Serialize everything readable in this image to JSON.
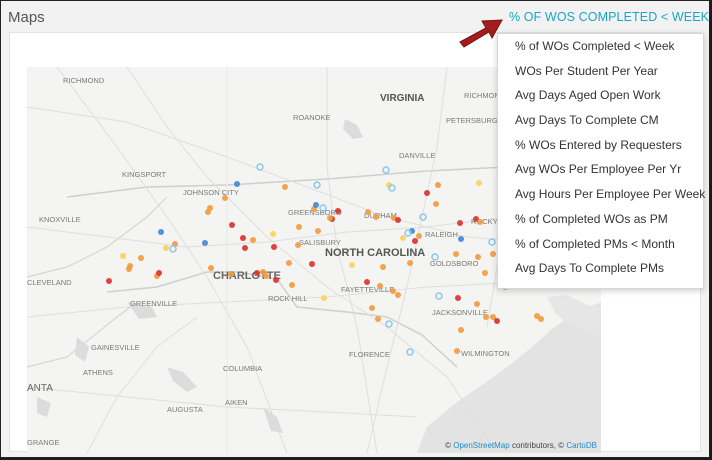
{
  "panel": {
    "title": "Maps"
  },
  "metric": {
    "selected": "% OF WOS COMPLETED < WEEK"
  },
  "menu": {
    "items": [
      "% of WOs Completed < Week",
      "WOs Per Student Per Year",
      "Avg Days Aged Open Work",
      "Avg Days To Complete CM",
      "% WOs Entered by Requesters",
      "Avg WOs Per Employee Per Yr",
      "Avg Hours Per Employee Per Week",
      "% of Completed WOs as PM",
      "% of Completed PMs < Month",
      "Avg Days To Complete PMs"
    ]
  },
  "map": {
    "regions": [
      "VIRGINIA",
      "NORTH CAROLINA"
    ],
    "cities": [
      "RICHMOND",
      "RICHMOND",
      "ROANOKE",
      "PETERSBURG",
      "DANVILLE",
      "KINGSPORT",
      "JOHNSON CITY",
      "KNOXVILLE",
      "GREENSBORO",
      "DURHAM",
      "ROCKY",
      "RALEIGH",
      "SALISBURY",
      "CHARLOTTE",
      "GOLDSBORO",
      "CLEVELAND",
      "GREENVILLE",
      "ROCK HILL",
      "FAYETTEVILLE",
      "JACKSONVILLE",
      "GAINESVILLE",
      "ATHENS",
      "COLUMBIA",
      "FLORENCE",
      "WILMINGTON",
      "AUGUSTA",
      "AIKEN",
      "ANTA",
      "GRANGE"
    ],
    "attribution": {
      "prefix": "©",
      "osm": "OpenStreetMap",
      "middle": "contributors, ©",
      "carto": "CartoDB"
    }
  },
  "colors": {
    "accent": "#1aa7c7",
    "arrow": "#a31d1d",
    "dot_red": "#d9322b",
    "dot_orange": "#f39a3c",
    "dot_yellow": "#f9d35a",
    "dot_blue": "#3f86d4",
    "dot_lightblue": "#8cc7ef"
  }
}
